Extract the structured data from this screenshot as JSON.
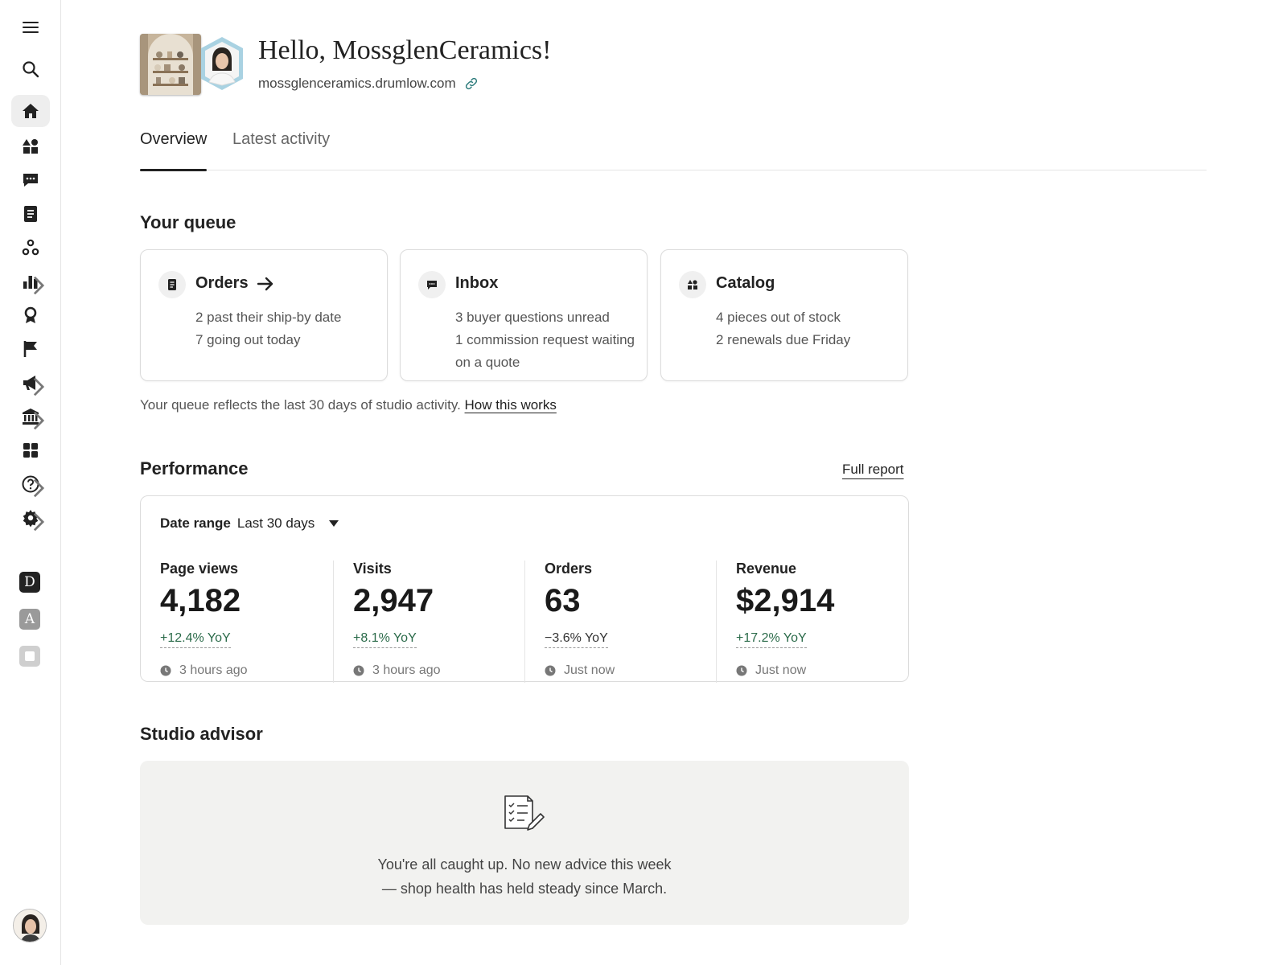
{
  "sidebar": {
    "items": [
      {
        "name": "menu-icon"
      },
      {
        "name": "search-icon"
      },
      {
        "name": "home-icon",
        "active": true
      },
      {
        "name": "shapes-icon"
      },
      {
        "name": "messages-icon"
      },
      {
        "name": "orders-document-icon"
      },
      {
        "name": "community-icon"
      },
      {
        "name": "stats-icon",
        "has_submenu": true
      },
      {
        "name": "ribbon-icon"
      },
      {
        "name": "flag-icon"
      },
      {
        "name": "megaphone-icon",
        "has_submenu": true
      },
      {
        "name": "bank-icon",
        "has_submenu": true
      },
      {
        "name": "apps-grid-icon"
      },
      {
        "name": "help-icon",
        "has_submenu": true
      },
      {
        "name": "settings-icon",
        "has_submenu": true
      }
    ],
    "letters": [
      {
        "label": "D",
        "bg": "#222222",
        "fg": "#ffffff"
      },
      {
        "label": "A",
        "bg": "#9a9a9a",
        "fg": "#ffffff"
      },
      {
        "label": "",
        "bg": "#cfcfcf",
        "fg": "#ffffff"
      }
    ]
  },
  "header": {
    "greeting": "Hello, MossglenCeramics!",
    "url": "mossglenceramics.drumlow.com"
  },
  "tabs": [
    {
      "label": "Overview",
      "active": true
    },
    {
      "label": "Latest activity",
      "active": false
    }
  ],
  "queue": {
    "title": "Your queue",
    "cards": [
      {
        "icon": "orders-icon",
        "title": "Orders",
        "arrow": true,
        "lines": [
          "2 past their ship-by date",
          "7 going out today"
        ]
      },
      {
        "icon": "chat-icon",
        "title": "Inbox",
        "arrow": false,
        "lines": [
          "3 buyer questions unread",
          "1 commission request waiting on a quote"
        ]
      },
      {
        "icon": "catalog-icon",
        "title": "Catalog",
        "arrow": false,
        "lines": [
          "4 pieces out of stock",
          "2 renewals due Friday"
        ]
      }
    ],
    "note": "Your queue reflects the last 30 days of studio activity.",
    "note_link": "How this works"
  },
  "performance": {
    "title": "Performance",
    "full_report": "Full report",
    "date_range_label": "Date range",
    "date_range_value": "Last 30 days",
    "metrics": [
      {
        "label": "Page views",
        "value": "4,182",
        "change": "+12.4% YoY",
        "direction": "up",
        "updated": "3 hours ago"
      },
      {
        "label": "Visits",
        "value": "2,947",
        "change": "+8.1% YoY",
        "direction": "up",
        "updated": "3 hours ago"
      },
      {
        "label": "Orders",
        "value": "63",
        "change": "−3.6% YoY",
        "direction": "down",
        "updated": "Just now"
      },
      {
        "label": "Revenue",
        "value": "$2,914",
        "change": "+17.2% YoY",
        "direction": "up",
        "updated": "Just now"
      }
    ]
  },
  "advisor": {
    "title": "Studio advisor",
    "message_line1": "You're all caught up. No new advice this week",
    "message_line2": "— shop health has held steady since March."
  },
  "colors": {
    "positive": "#2b6b4a",
    "text": "#222222",
    "muted": "#666666",
    "border": "#dcdcdc",
    "advisor_bg": "#f2f2f0"
  }
}
